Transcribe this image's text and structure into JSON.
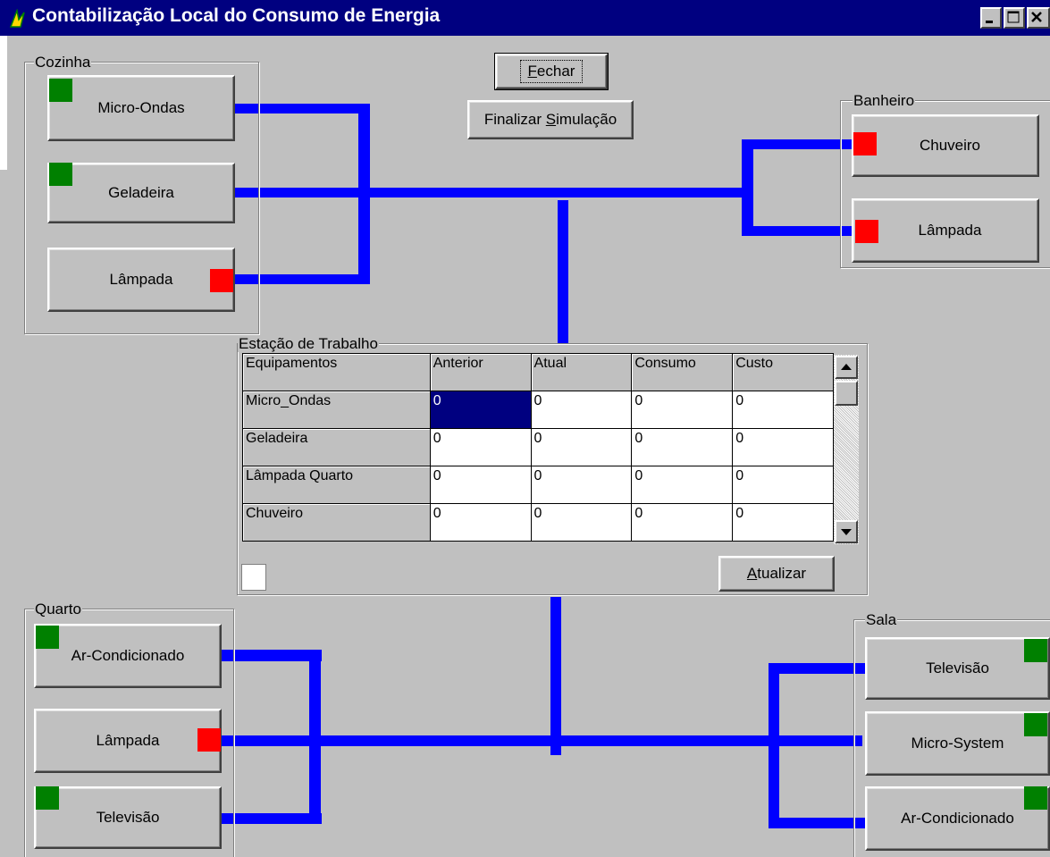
{
  "window": {
    "title": "Contabilização Local do Consumo de Energia",
    "controls": {
      "minimize": "_",
      "maximize": "□",
      "close": "×"
    }
  },
  "actions": {
    "close_label_pre": "",
    "close_label_key": "F",
    "close_label_post": "echar",
    "finish_label_pre": "Finalizar ",
    "finish_label_key": "S",
    "finish_label_post": "imulação"
  },
  "rooms": {
    "cozinha": {
      "title": "Cozinha",
      "items": [
        "Micro-Ondas",
        "Geladeira",
        "Lâmpada"
      ],
      "states": [
        "on",
        "on",
        "off"
      ]
    },
    "banheiro": {
      "title": "Banheiro",
      "items": [
        "Chuveiro",
        "Lâmpada"
      ],
      "states": [
        "off",
        "off"
      ]
    },
    "quarto": {
      "title": "Quarto",
      "items": [
        "Ar-Condicionado",
        "Lâmpada",
        "Televisão"
      ],
      "states": [
        "on",
        "off",
        "on"
      ]
    },
    "sala": {
      "title": "Sala",
      "items": [
        "Televisão",
        "Micro-System",
        "Ar-Condicionado"
      ],
      "states": [
        "on",
        "on",
        "on"
      ]
    }
  },
  "workstation": {
    "title": "Estação de Trabalho",
    "columns": [
      "Equipamentos",
      "Anterior",
      "Atual",
      "Consumo",
      "Custo"
    ],
    "rows": [
      [
        "Micro_Ondas",
        "0",
        "0",
        "0",
        "0"
      ],
      [
        "Geladeira",
        "0",
        "0",
        "0",
        "0"
      ],
      [
        "Lâmpada Quarto",
        "0",
        "0",
        "0",
        "0"
      ],
      [
        "Chuveiro",
        "0",
        "0",
        "0",
        "0"
      ]
    ],
    "update_label_key": "A",
    "update_label_post": "tualizar"
  },
  "colors": {
    "on": "#008000",
    "off": "#ff0000",
    "wire": "#0000ff",
    "title_bar": "#000080",
    "face": "#c0c0c0"
  }
}
